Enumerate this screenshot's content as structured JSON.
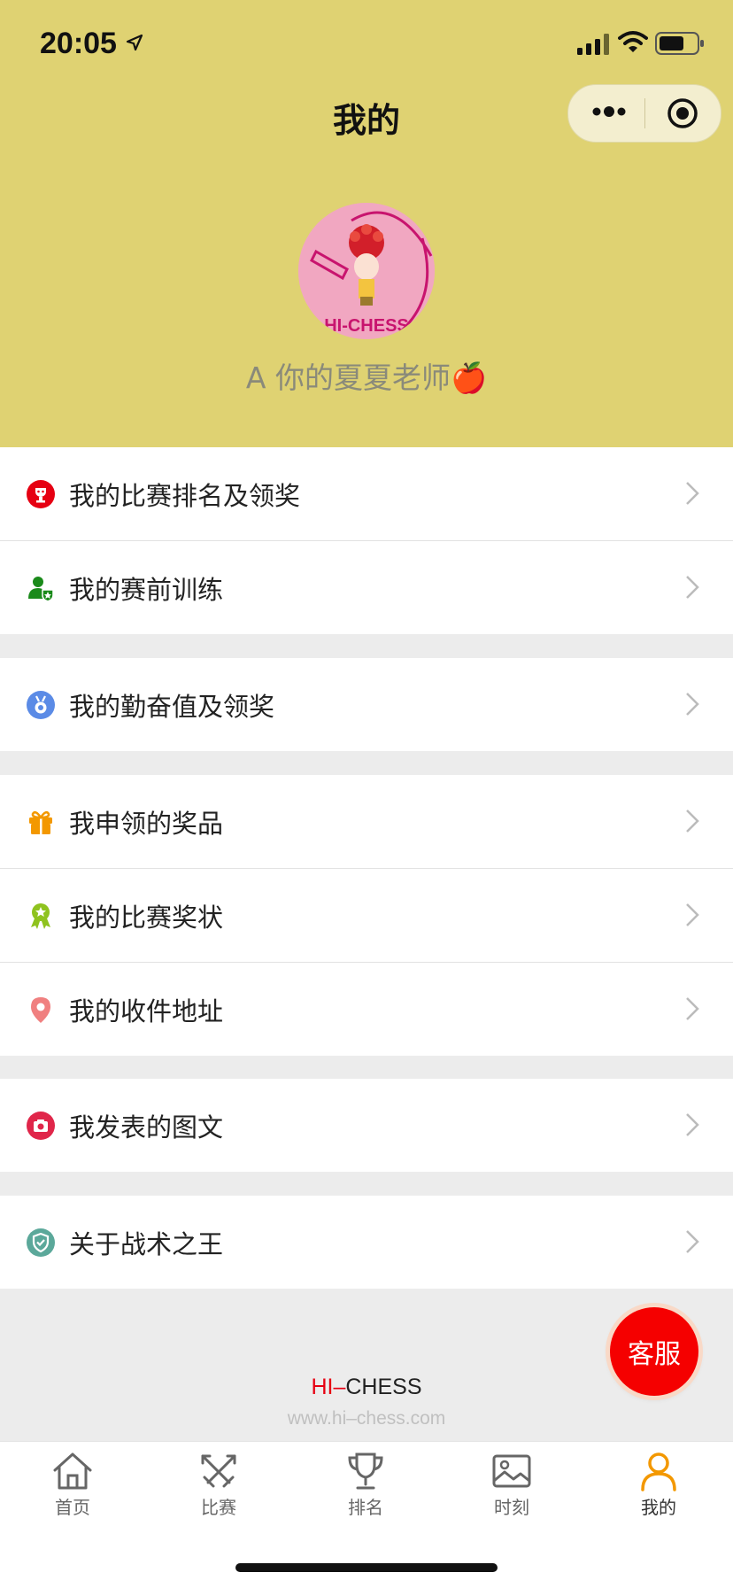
{
  "status_bar": {
    "time": "20:05"
  },
  "nav": {
    "title": "我的"
  },
  "profile": {
    "name": "A 你的夏夏老师",
    "emoji": "🍎",
    "avatar_text": "HI-CHESS"
  },
  "menu_groups": [
    [
      {
        "label": "我的比赛排名及领奖",
        "icon": "trophy-icon",
        "color": "#e60012"
      },
      {
        "label": "我的赛前训练",
        "icon": "user-badge-icon",
        "color": "#1a8a1a"
      }
    ],
    [
      {
        "label": "我的勤奋值及领奖",
        "icon": "medal-icon",
        "color": "#5b8be6"
      }
    ],
    [
      {
        "label": "我申领的奖品",
        "icon": "gift-icon",
        "color": "#f39800"
      },
      {
        "label": "我的比赛奖状",
        "icon": "award-icon",
        "color": "#8fc31f"
      },
      {
        "label": "我的收件地址",
        "icon": "location-pin-icon",
        "color": "#f08080"
      }
    ],
    [
      {
        "label": "我发表的图文",
        "icon": "camera-icon",
        "color": "#e0264a"
      }
    ],
    [
      {
        "label": "关于战术之王",
        "icon": "shield-icon",
        "color": "#5ba89a"
      }
    ]
  ],
  "footer": {
    "brand_hi": "HI",
    "brand_dash": "–",
    "brand_rest": "CHESS",
    "url": "www.hi–chess.com"
  },
  "service_button": {
    "label": "客服"
  },
  "tabbar": {
    "items": [
      {
        "label": "首页",
        "icon": "home-icon"
      },
      {
        "label": "比赛",
        "icon": "swords-icon"
      },
      {
        "label": "排名",
        "icon": "trophy-cup-icon"
      },
      {
        "label": "时刻",
        "icon": "image-icon"
      },
      {
        "label": "我的",
        "icon": "person-icon",
        "active": true
      }
    ],
    "active_color": "#f39800"
  }
}
